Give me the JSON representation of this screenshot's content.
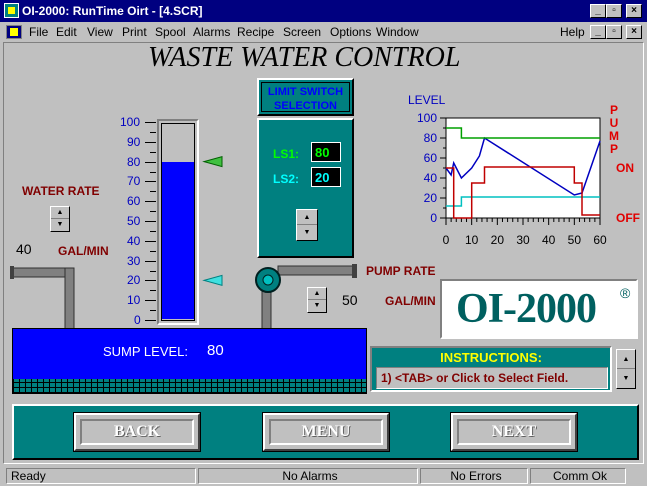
{
  "window": {
    "title": "OI-2000: RunTime Oirt - [4.SCR]"
  },
  "menu": {
    "items": [
      "File",
      "Edit",
      "View",
      "Print",
      "Spool",
      "Alarms",
      "Recipe",
      "Screen",
      "Options",
      "Window"
    ],
    "help": "Help"
  },
  "heading": "WASTE WATER CONTROL",
  "water_rate": {
    "label": "WATER RATE",
    "value": "40",
    "unit": "GAL/MIN"
  },
  "tank_gauge": {
    "ticks": [
      "100",
      "90",
      "80",
      "70",
      "60",
      "50",
      "40",
      "30",
      "20",
      "10",
      "0"
    ],
    "level": 80,
    "ls1_marker": 80,
    "ls2_marker": 20
  },
  "limit_switch": {
    "title_line1": "LIMIT SWITCH",
    "title_line2": "SELECTION",
    "ls1_label": "LS1:",
    "ls1_value": "80",
    "ls2_label": "LS2:",
    "ls2_value": "20"
  },
  "trend_chart": {
    "level_label": "LEVEL",
    "pump_label_letters": [
      "P",
      "U",
      "M",
      "P"
    ],
    "on_label": "ON",
    "off_label": "OFF",
    "y_ticks": [
      "100",
      "80",
      "60",
      "40",
      "20",
      "0"
    ],
    "x_ticks": [
      "0",
      "10",
      "20",
      "30",
      "40",
      "50",
      "60"
    ],
    "colors": {
      "level": "#0000c0",
      "ls1": "#00a000",
      "ls2": "#00c0c0",
      "pump": "#c00000"
    }
  },
  "chart_data": {
    "type": "line",
    "xlim": [
      0,
      60
    ],
    "ylim": [
      0,
      100
    ],
    "series": [
      {
        "x": [
          0,
          2,
          3,
          6,
          10,
          13,
          15,
          50,
          53,
          60
        ],
        "values": [
          50,
          43,
          55,
          40,
          50,
          62,
          80,
          23,
          25,
          77
        ]
      },
      {
        "x": [
          0,
          6,
          6,
          60
        ],
        "values": [
          90,
          90,
          80,
          80
        ]
      },
      {
        "x": [
          0,
          6,
          6,
          60
        ],
        "values": [
          12,
          12,
          21,
          21
        ]
      },
      {
        "x": [
          0,
          3,
          3,
          10,
          10,
          15,
          15,
          50,
          50,
          53,
          53,
          60
        ],
        "values": [
          50,
          50,
          0,
          0,
          35,
          35,
          51,
          51,
          35,
          35,
          3,
          3
        ]
      }
    ]
  },
  "pump_rate": {
    "label": "PUMP RATE",
    "unit": "GAL/MIN",
    "value": "50"
  },
  "logo": {
    "text": "OI-2000",
    "mark": "®"
  },
  "sump": {
    "label": "SUMP LEVEL:",
    "value": "80"
  },
  "instructions": {
    "title": "INSTRUCTIONS:",
    "text": "1) <TAB> or Click to Select Field."
  },
  "nav": {
    "back": "BACK",
    "menu": "MENU",
    "next": "NEXT"
  },
  "status": {
    "ready": "Ready",
    "alarms": "No Alarms",
    "errors": "No Errors",
    "comm": "Comm Ok"
  }
}
